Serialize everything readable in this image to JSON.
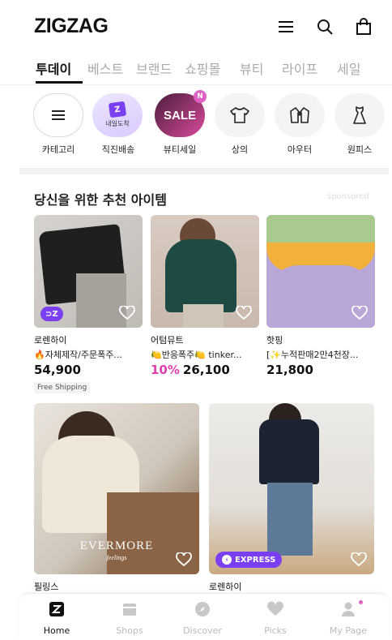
{
  "app": {
    "logo": "ZIGZAG"
  },
  "tabs": [
    {
      "label": "투데이",
      "active": true
    },
    {
      "label": "베스트"
    },
    {
      "label": "브랜드"
    },
    {
      "label": "쇼핑몰"
    },
    {
      "label": "뷰티"
    },
    {
      "label": "라이프"
    },
    {
      "label": "세일"
    }
  ],
  "categories": [
    {
      "label": "카테고리",
      "icon": "menu-icon"
    },
    {
      "label": "직진배송",
      "icon": "next-day-delivery-icon",
      "tile_text": "내일도착",
      "cube_text": "Z"
    },
    {
      "label": "뷰티세일",
      "icon": "sale-tile",
      "tile_text": "SALE",
      "badge": "N"
    },
    {
      "label": "상의",
      "icon": "tshirt-icon"
    },
    {
      "label": "아우터",
      "icon": "jacket-icon"
    },
    {
      "label": "원피스",
      "icon": "dress-icon"
    }
  ],
  "recommend": {
    "title": "당신을 위한 추천 아이템",
    "sponsored": "sponsored",
    "items": [
      {
        "store": "로렌하이",
        "desc": "🔥자체제작/주문폭주...",
        "price": "54,900",
        "discount": "",
        "tag": "Free Shipping",
        "badge": "Z"
      },
      {
        "store": "어텀뮤트",
        "desc": "🍋반응폭주🍋 tinker...",
        "price": "26,100",
        "discount": "10%",
        "tag": "",
        "badge": ""
      },
      {
        "store": "핫핑",
        "desc": "[✨누적판매2만4천장...",
        "price": "21,800",
        "discount": "",
        "tag": "",
        "badge": ""
      }
    ],
    "large_items": [
      {
        "store": "필링스",
        "overlay_brand": "EVERMORE",
        "overlay_sub": "feelings",
        "badge": ""
      },
      {
        "store": "로렌하이",
        "badge": "EXPRESS"
      }
    ]
  },
  "bottom_nav": [
    {
      "label": "Home",
      "active": true
    },
    {
      "label": "Shops"
    },
    {
      "label": "Discover"
    },
    {
      "label": "Picks"
    },
    {
      "label": "My Page"
    }
  ],
  "colors": {
    "accent": "#7b3ff2",
    "pink": "#e03fb0"
  }
}
